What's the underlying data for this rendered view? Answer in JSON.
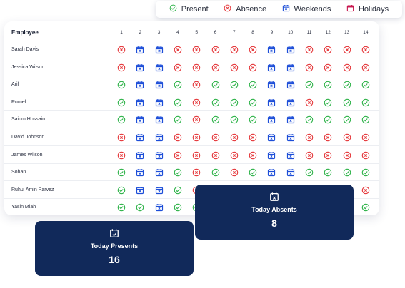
{
  "legend": [
    {
      "status": "present",
      "label": "Present",
      "icon": "check-circle-icon"
    },
    {
      "status": "absent",
      "label": "Absence",
      "icon": "x-circle-icon"
    },
    {
      "status": "weekend",
      "label": "Weekends",
      "icon": "calendar-x-icon"
    },
    {
      "status": "holiday",
      "label": "Holidays",
      "icon": "calendar-icon"
    }
  ],
  "colors": {
    "present": "#2fb34a",
    "absent": "#e5383b",
    "weekend": "#1d4ed8",
    "holiday": "#c8174f",
    "card_bg": "#11295a"
  },
  "table": {
    "header": "Employee",
    "days": [
      "1",
      "2",
      "3",
      "4",
      "5",
      "6",
      "7",
      "8",
      "9",
      "10",
      "11",
      "12",
      "13",
      "14"
    ],
    "rows": [
      {
        "name": "Sarah Davis",
        "status": "AWWAAAAAWWAAAAA"
      },
      {
        "name": "Jessica Wilson",
        "status": "AWWAAAAAWWAAAAA"
      },
      {
        "name": "Arif",
        "status": "PWWPAPPPWWPPPPA"
      },
      {
        "name": "Rumel",
        "status": "PWWPAPPPWWAPPPA"
      },
      {
        "name": "Saium Hossain",
        "status": "PWWPAPPPWWPPPPA"
      },
      {
        "name": "David Johnson",
        "status": "AWWAAAAAWWAAAAA"
      },
      {
        "name": "James Wilson",
        "status": "AWWAAAAAWWAAAAA"
      },
      {
        "name": "Sohan",
        "status": "PWWPAPAPWWPPPPA"
      },
      {
        "name": "Ruhul Amin Parvez",
        "status": "PWWPAPPPWWPPPAA"
      },
      {
        "name": "Yasin Miah",
        "status": "PPWPPPPPWWPPPPA"
      }
    ]
  },
  "today_absents": {
    "label": "Today Absents",
    "value": "8",
    "icon": "calendar-x-icon"
  },
  "today_presents": {
    "label": "Today Presents",
    "value": "16",
    "icon": "calendar-check-icon"
  }
}
